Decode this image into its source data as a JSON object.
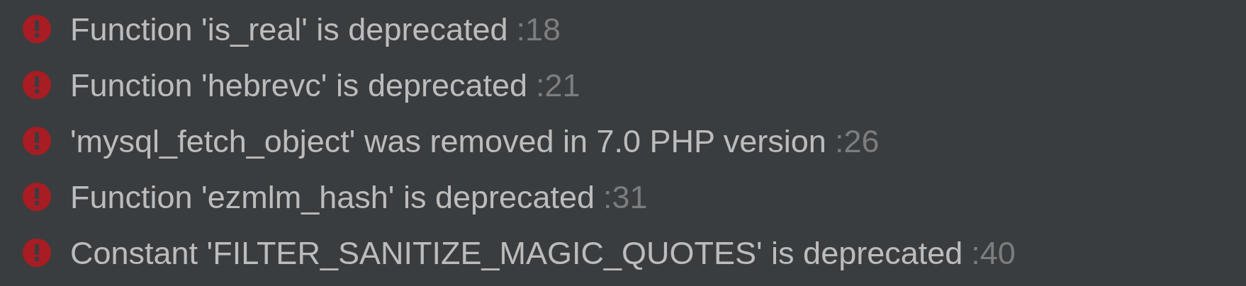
{
  "problems": [
    {
      "message": "Function 'is_real' is deprecated",
      "line": ":18"
    },
    {
      "message": "Function 'hebrevc' is deprecated",
      "line": ":21"
    },
    {
      "message": "'mysql_fetch_object' was removed in 7.0 PHP version",
      "line": ":26"
    },
    {
      "message": "Function 'ezmlm_hash' is deprecated",
      "line": ":31"
    },
    {
      "message": "Constant 'FILTER_SANITIZE_MAGIC_QUOTES' is deprecated",
      "line": ":40"
    }
  ]
}
